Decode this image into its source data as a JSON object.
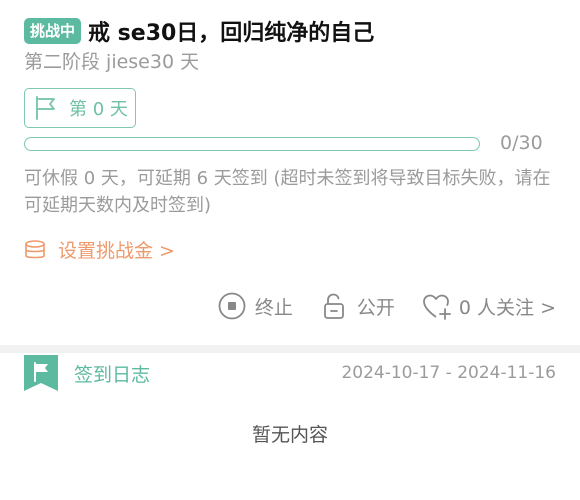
{
  "challenge": {
    "status_badge": "挑战中",
    "title": "戒 se30日，回归纯净的自己",
    "subtitle": "第二阶段 jiese30 天",
    "day_label": "第 0 天",
    "progress": {
      "current": 0,
      "total": 30,
      "text": "0/30"
    },
    "notice": "可休假 0 天，可延期 6 天签到 (超时未签到将导致目标失败，请在可延期天数内及时签到)",
    "deposit_label": "设置挑战金 >"
  },
  "actions": {
    "end_label": "终止",
    "public_label": "公开",
    "follow_label": "0 人关注 >"
  },
  "log": {
    "title": "签到日志",
    "date_range": "2024-10-17 - 2024-11-16",
    "empty_text": "暂无内容"
  },
  "icons": {
    "flag": "flag-outline-icon",
    "coin": "coin-stack-icon",
    "stop": "stop-circle-icon",
    "lock": "lock-open-icon",
    "heart": "heart-plus-icon",
    "log_flag": "flag-bookmark-icon"
  },
  "colors": {
    "accent": "#5cbaa0",
    "accent_light": "#7fc9b2",
    "orange": "#ef9a6c",
    "muted": "#9b9b9b"
  }
}
